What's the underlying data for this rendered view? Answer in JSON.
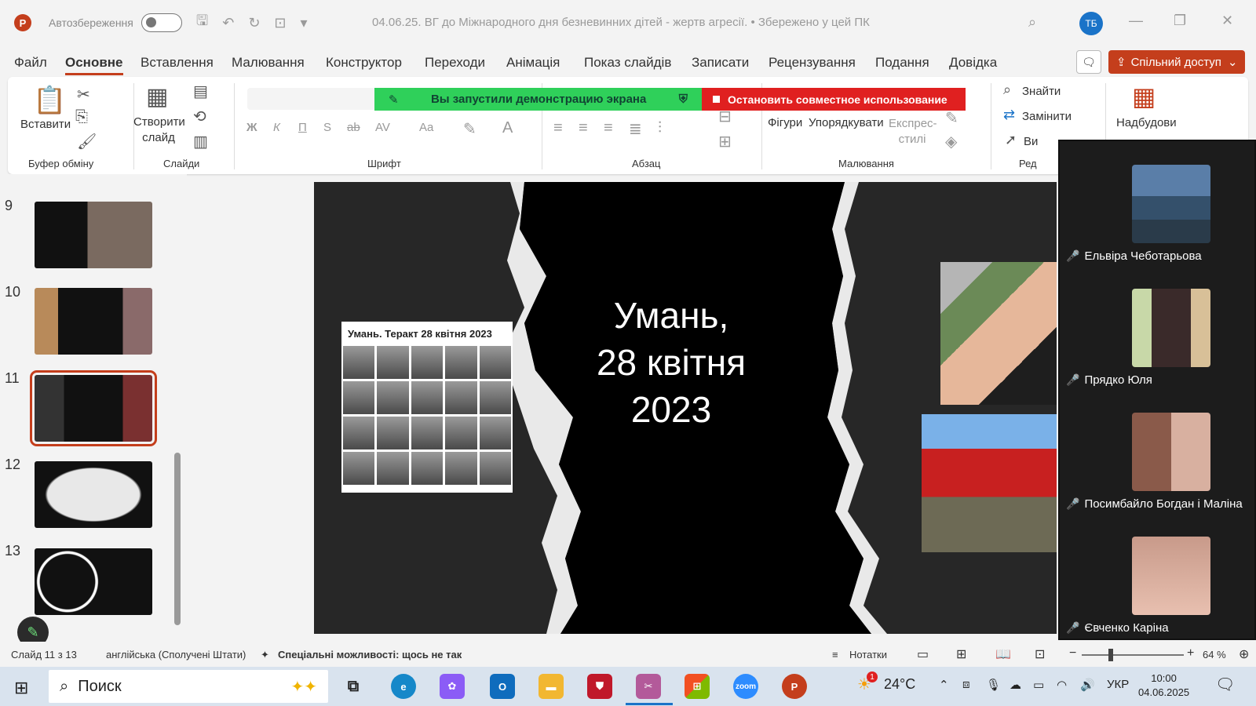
{
  "titlebar": {
    "app_letter": "P",
    "autosave_label": "Автозбереження",
    "document_title": "04.06.25. ВГ до Міжнародного дня безневинних дітей - жертв агресії. • Збережено у цей ПК",
    "user_initials": "ТБ"
  },
  "menu": {
    "tabs": [
      "Файл",
      "Основне",
      "Вставлення",
      "Малювання",
      "Конструктор",
      "Переходи",
      "Анімація",
      "Показ слайдів",
      "Записати",
      "Рецензування",
      "Подання",
      "Довідка"
    ],
    "share_label": "Спільний доступ"
  },
  "ribbon": {
    "paste": "Вставити",
    "clipboard_group": "Буфер обміну",
    "new_slide_line1": "Створити",
    "new_slide_line2": "слайд",
    "slides_group": "Слайди",
    "font_group": "Шрифт",
    "paragraph_group": "Абзац",
    "shapes": "Фігури",
    "arrange": "Упорядкувати",
    "quick_styles_line1": "Експрес-",
    "quick_styles_line2": "стилі",
    "drawing_group": "Малювання",
    "find": "Знайти",
    "replace": "Замінити",
    "select": "Ви",
    "editing_group": "Ред",
    "addins": "Надбудови",
    "font_buttons": [
      "Ж",
      "К",
      "П",
      "S",
      "ab",
      "AV",
      "Aa"
    ]
  },
  "share_banner": {
    "started_text": "Вы запустили демонстрацию экрана",
    "stop_text": "Остановить совместное использование"
  },
  "thumbnails": {
    "numbers": [
      "9",
      "10",
      "11",
      "12",
      "13"
    ],
    "selected": "11"
  },
  "slide": {
    "title_line1": "Умань,",
    "title_line2": "28 квітня",
    "title_line3": "2023",
    "card_title": "Умань. Теракт 28 квітня 2023"
  },
  "participants": [
    {
      "name": "Ельвіра Чеботарьова"
    },
    {
      "name": "Прядко Юля"
    },
    {
      "name": "Посимбайло Богдан і Маліна"
    },
    {
      "name": "Євченко Каріна"
    }
  ],
  "statusbar": {
    "slide_pos": "Слайд 11 з 13",
    "language": "англійська (Сполучені Штати)",
    "accessibility": "Спеціальні можливості: щось не так",
    "notes": "Нотатки",
    "zoom": "64 %"
  },
  "taskbar": {
    "search": "Поиск",
    "weather": "24°C",
    "lang": "УКР",
    "time": "10:00",
    "date": "04.06.2025",
    "weather_badge": "1"
  },
  "colors": {
    "accent": "#c43e1c",
    "share_green": "#2fd05a",
    "share_red": "#e02020"
  }
}
